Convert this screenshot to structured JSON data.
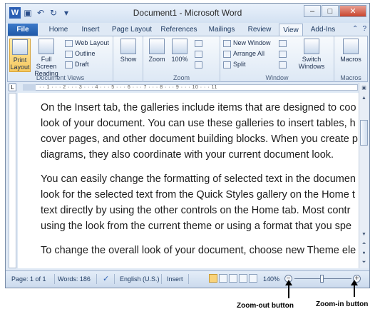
{
  "window": {
    "title": "Document1 - Microsoft Word",
    "app_icon": "W",
    "controls": [
      "–",
      "□",
      "✕"
    ]
  },
  "quick_access": [
    "save-icon",
    "undo-icon",
    "redo-icon",
    "customize-icon"
  ],
  "tabs": [
    {
      "label": "File"
    },
    {
      "label": "Home"
    },
    {
      "label": "Insert"
    },
    {
      "label": "Page Layout"
    },
    {
      "label": "References"
    },
    {
      "label": "Mailings"
    },
    {
      "label": "Review"
    },
    {
      "label": "View"
    },
    {
      "label": "Add-Ins"
    }
  ],
  "active_tab": "View",
  "ribbon": {
    "document_views": {
      "label": "Document Views",
      "print_layout": "Print Layout",
      "full_screen_reading": "Full Screen Reading",
      "web_layout": "Web Layout",
      "outline": "Outline",
      "draft": "Draft"
    },
    "show": {
      "label": "Show"
    },
    "zoom": {
      "label": "Zoom",
      "zoom_btn": "Zoom",
      "hundred": "100%"
    },
    "window": {
      "label": "Window",
      "new_window": "New Window",
      "arrange_all": "Arrange All",
      "split": "Split",
      "switch_windows": "Switch Windows"
    },
    "macros": {
      "label": "Macros",
      "macros_btn": "Macros"
    }
  },
  "ruler": {
    "corner": "L",
    "ticks": "· · 1 · · · 2 · · · 3 · · · 4 · · · 5 · · · 6 · · · 7 · · · 8 · · · 9 · · · 10 · · · 11"
  },
  "document": {
    "p1": [
      "On the Insert tab, the galleries include items that are designed to coo",
      "look of your document. You can use these galleries to insert tables, h",
      "cover pages, and other document building blocks. When you create p",
      "diagrams, they also coordinate with your current document look."
    ],
    "p2": [
      "You can easily change the formatting of selected text in the documen",
      "look for the selected text from the Quick Styles gallery on the Home t",
      "text directly by using the other controls on the Home tab. Most contr",
      "using the look from the current theme or using a format that you spe"
    ],
    "p3": [
      "To change the overall look of your document, choose new Theme ele"
    ]
  },
  "status": {
    "page": "Page: 1 of 1",
    "words": "Words: 186",
    "language": "English (U.S.)",
    "mode": "Insert",
    "zoom": "140%",
    "zoom_out": "−",
    "zoom_in": "+"
  },
  "annotations": {
    "zoom_out": "Zoom-out button",
    "zoom_in": "Zoom-in button"
  }
}
